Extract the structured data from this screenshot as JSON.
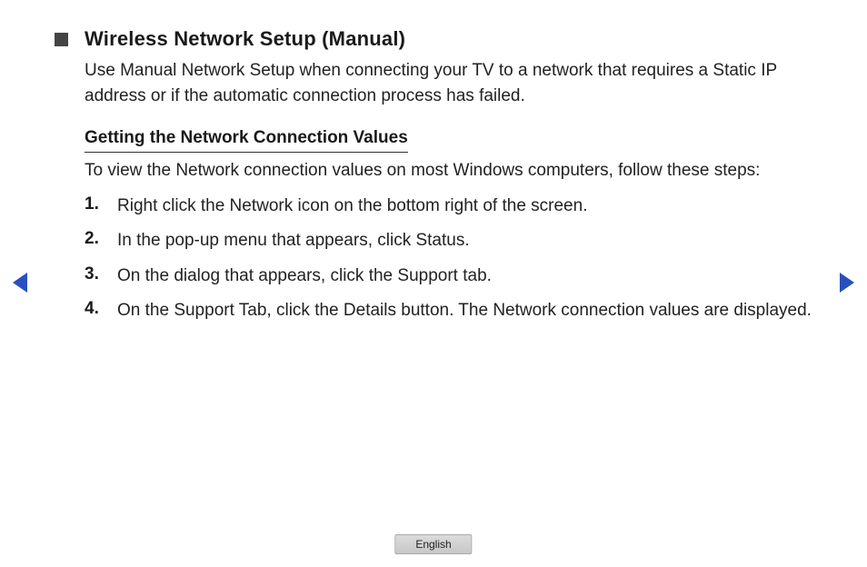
{
  "title": "Wireless Network Setup (Manual)",
  "intro": "Use Manual Network Setup when connecting your TV to a network that requires a Static IP address or if the automatic connection process has failed.",
  "subtitle": "Getting the Network Connection Values",
  "lead": "To view the Network connection values on most Windows computers, follow these steps:",
  "steps": [
    {
      "num": "1.",
      "text": "Right click the Network icon on the bottom right of the screen."
    },
    {
      "num": "2.",
      "text": "In the pop-up menu that appears, click Status."
    },
    {
      "num": "3.",
      "text": "On the dialog that appears, click the Support tab."
    },
    {
      "num": "4.",
      "text": "On the Support Tab, click the Details button. The Network connection values are displayed."
    }
  ],
  "language": "English",
  "colors": {
    "arrow": "#2a4fbf"
  }
}
